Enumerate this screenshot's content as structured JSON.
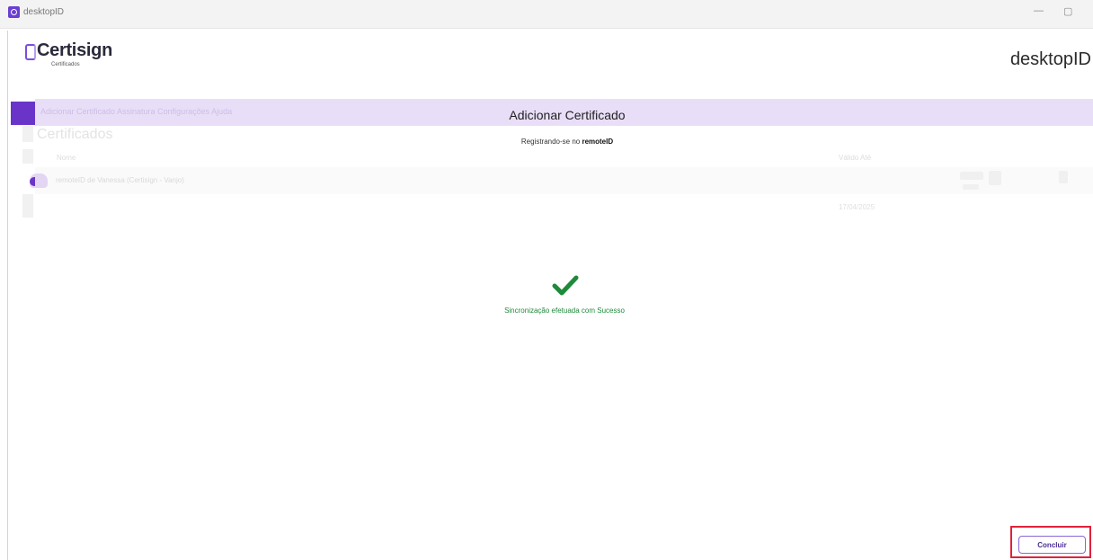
{
  "window": {
    "title": "desktopID",
    "minimize": "—",
    "maximize": "▢"
  },
  "header": {
    "brand": "Certisign",
    "brand_sub": "Certificados",
    "app_name": "desktopID"
  },
  "background": {
    "nav": "Adicionar Certificado   Assinatura   Configurações   Ajuda",
    "heading": "Certificados",
    "columns": {
      "name": "Nome",
      "valid_until": "Válido Até"
    },
    "row": {
      "name": "remoteID de Vanessa (Certisign - Vanjo)",
      "date": "17/04/2025"
    }
  },
  "dialog": {
    "title": "Adicionar Certificado",
    "subtitle_prefix": "Registrando-se no ",
    "subtitle_emphasis": "remoteID",
    "success_message": "Sincronização efetuada com Sucesso",
    "confirm_label": "Concluir"
  },
  "colors": {
    "accent": "#6b34c9",
    "band": "#e9def7",
    "success": "#1e8a3a",
    "highlight": "#e0223a"
  },
  "icons": {
    "check": "check-icon",
    "app": "desktopid-app-icon",
    "logo": "certisign-logo-icon"
  }
}
